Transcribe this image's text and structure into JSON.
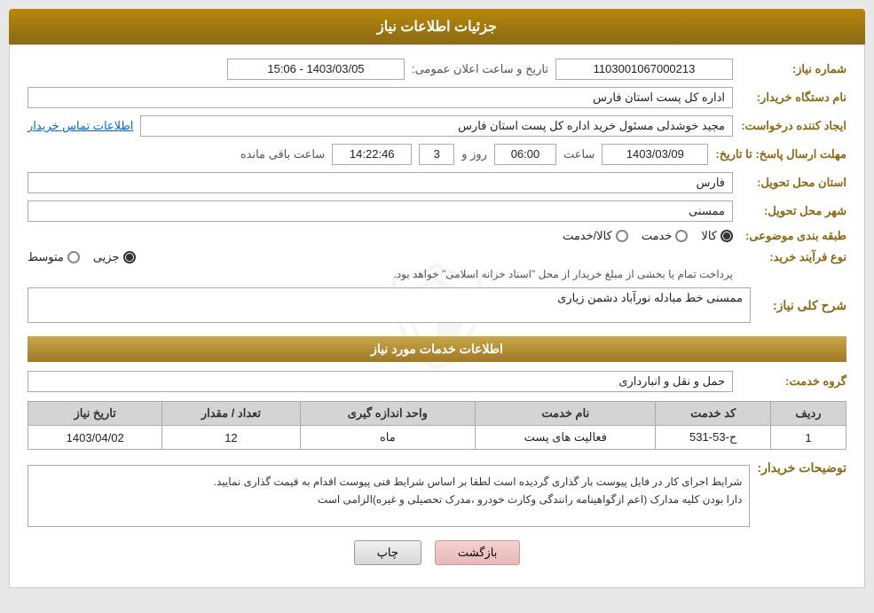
{
  "page": {
    "title": "جزئیات اطلاعات نیاز",
    "services_section_title": "اطلاعات خدمات مورد نیاز"
  },
  "labels": {
    "need_number": "شماره نیاز:",
    "buyer_org": "نام دستگاه خریدار:",
    "creator": "ایجاد کننده درخواست:",
    "send_deadline": "مهلت ارسال پاسخ: تا تاریخ:",
    "province_delivery": "استان محل تحویل:",
    "city_delivery": "شهر محل تحویل:",
    "subject_type": "طبقه بندی موضوعی:",
    "purchase_type": "نوع فرآیند خرید:",
    "general_description": "شرح کلی نیاز:",
    "service_group": "گروه خدمت:",
    "buyer_notes": "توضیحات خریدار:",
    "date_announcement": "تاریخ و ساعت اعلان عمومی:"
  },
  "values": {
    "need_number": "1103001067000213",
    "buyer_org": "اداره کل پست استان فارس",
    "creator": "مجید خوشدلی مسئول خرید اداره کل پست استان فارس",
    "contact_info_link": "اطلاعات تماس خریدار",
    "date": "1403/03/09",
    "time_label": "ساعت",
    "time": "06:00",
    "days_label": "روز و",
    "days": "3",
    "remaining_label": "ساعت باقی مانده",
    "remaining_time": "14:22:46",
    "announcement_date": "1403/03/05 - 15:06",
    "province": "فارس",
    "city": "ممسنی",
    "subject_type_options": [
      "کالا",
      "خدمت",
      "کالا/خدمت"
    ],
    "subject_type_selected": "کالا",
    "purchase_options": [
      "جزیی",
      "متوسط"
    ],
    "purchase_note": "پرداخت تمام یا بخشی از مبلغ خریدار از محل \"اسناد خزانه اسلامی\" خواهد بود.",
    "description": "ممسنی خط مبادله نورآباد دشمن زیاری",
    "service_group": "حمل و نقل و انبارداری",
    "buyer_notes_text": "شرایط اجرای کار در فایل پیوست بار گذاری گردیده است لطفا بر اساس شرایط فنی پیوست اقدام به قیمت گذاری نمایید.\nدارا بودن کلیه مدارک (اعم ازگواهینامه رانندگی وکارت خودرو ،مدرک تحصیلی و غیره)الزامی است"
  },
  "table": {
    "headers": [
      "ردیف",
      "کد خدمت",
      "نام خدمت",
      "واحد اندازه گیری",
      "تعداد / مقدار",
      "تاریخ نیاز"
    ],
    "rows": [
      {
        "row": "1",
        "service_code": "ح-53-531",
        "service_name": "فعالیت های پست",
        "unit": "ماه",
        "quantity": "12",
        "date": "1403/04/02"
      }
    ]
  },
  "buttons": {
    "print": "چاپ",
    "back": "بازگشت"
  }
}
